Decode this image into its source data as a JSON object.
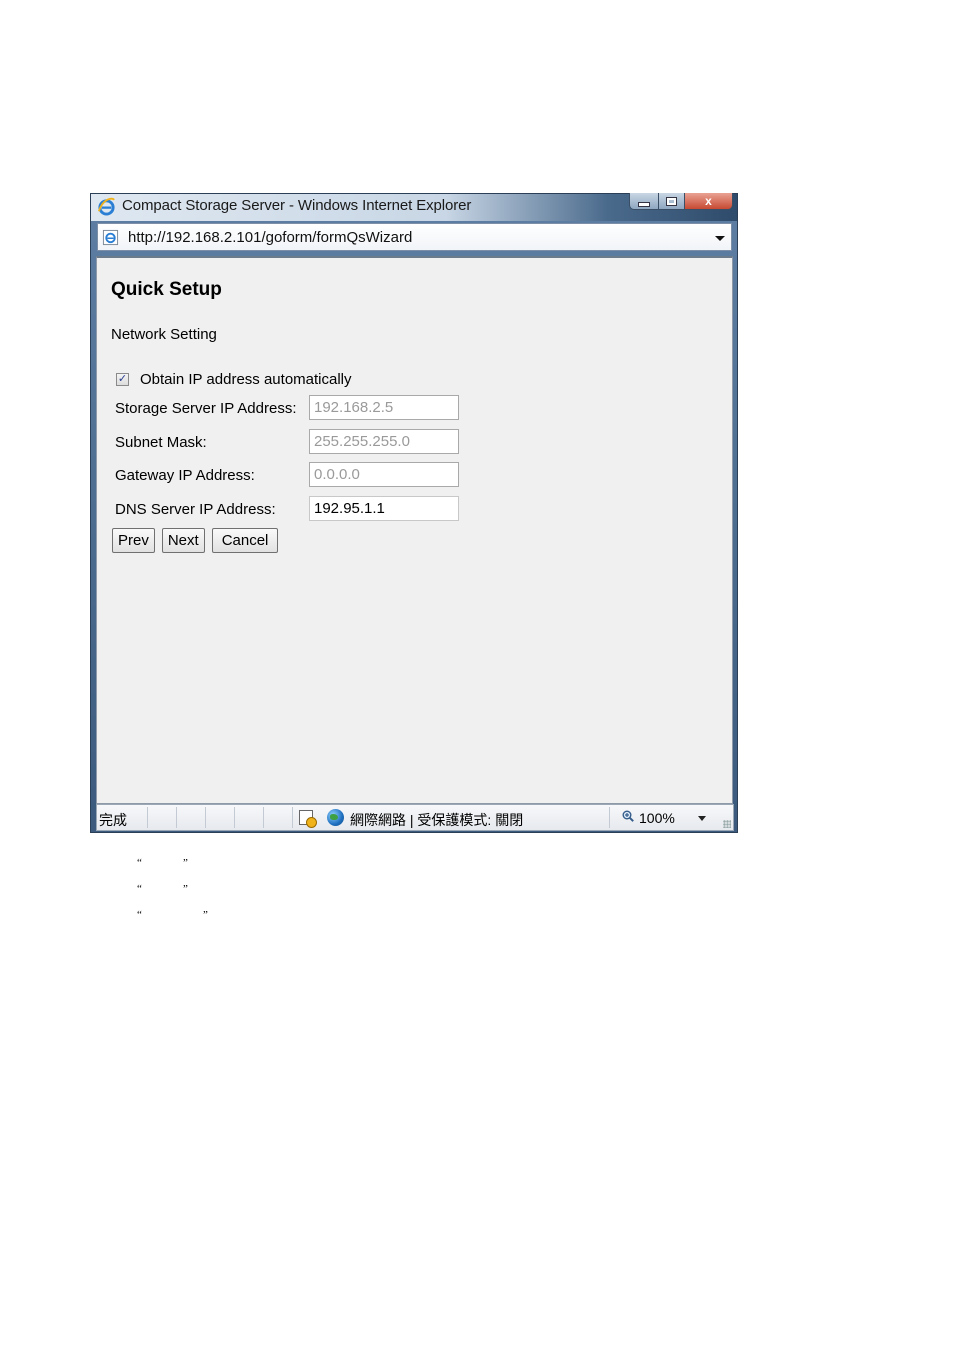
{
  "window": {
    "title": "Compact Storage Server - Windows Internet Explorer",
    "address": "http://192.168.2.101/goform/formQsWizard",
    "close_glyph": "x"
  },
  "page": {
    "heading": "Quick Setup",
    "section": "Network Setting",
    "obtain_auto": {
      "label": "Obtain IP address automatically",
      "checked": true,
      "check_glyph": "✓"
    },
    "fields": [
      {
        "label": "Storage Server IP Address:",
        "value": "192.168.2.5",
        "enabled": false
      },
      {
        "label": "Subnet Mask:",
        "value": "255.255.255.0",
        "enabled": false
      },
      {
        "label": "Gateway IP Address:",
        "value": "0.0.0.0",
        "enabled": false
      },
      {
        "label": "DNS Server IP Address:",
        "value": "192.95.1.1",
        "enabled": true
      }
    ],
    "buttons": {
      "prev": "Prev",
      "next": "Next",
      "cancel": "Cancel"
    }
  },
  "statusbar": {
    "status": "完成",
    "zone": "網際網路 | 受保護模式: 關閉",
    "zoom": "100%"
  },
  "quotes": [
    {
      "open": "“",
      "close": "”"
    },
    {
      "open": "“",
      "close": "”"
    },
    {
      "open": "“",
      "close": "”"
    }
  ]
}
